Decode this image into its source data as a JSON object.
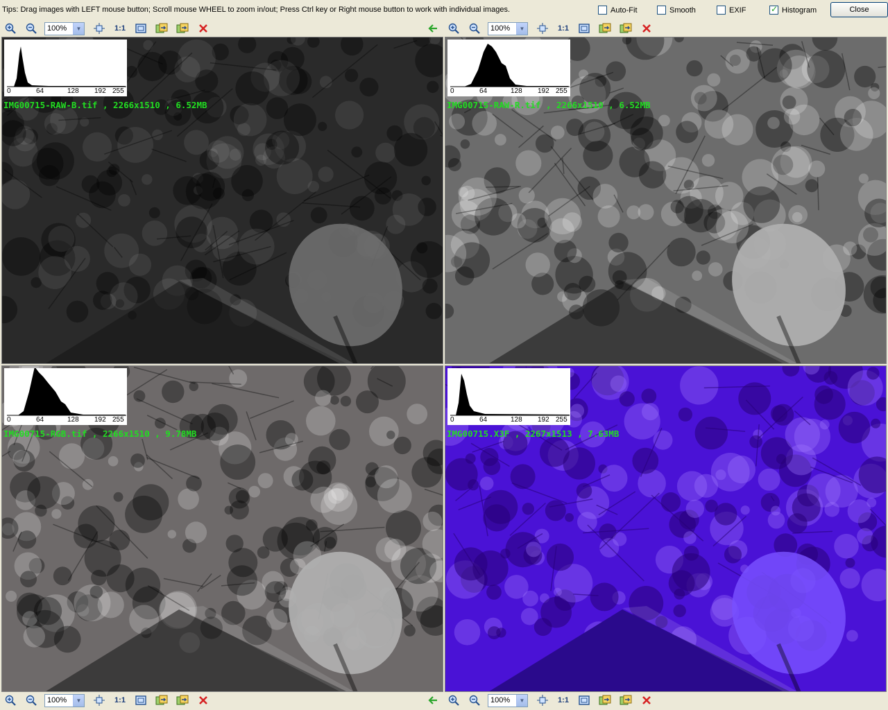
{
  "tips": "Tips: Drag images with LEFT mouse button; Scroll mouse WHEEL to zoom in/out; Press Ctrl key or Right mouse button to work with individual images.",
  "options": [
    {
      "label": "Auto-Fit",
      "checked": false
    },
    {
      "label": "Smooth",
      "checked": false
    },
    {
      "label": "EXIF",
      "checked": false
    },
    {
      "label": "Histogram",
      "checked": true
    }
  ],
  "close_label": "Close",
  "toolbar": {
    "zoom_value": "100%",
    "actual_size_label": "1:1",
    "icons": [
      "zoom-in-icon",
      "zoom-out-icon",
      "fit-icon",
      "actual-size-icon",
      "full-screen-icon",
      "rotate-left-icon",
      "rotate-right-icon",
      "close-image-icon"
    ]
  },
  "histogram_ticks": [
    "0",
    "64",
    "128",
    "192",
    "255"
  ],
  "panels": [
    {
      "caption": "IMG00715-RAW-B.tif , 2266x1510 , 6.52MB",
      "tint": "#2a2a2a"
    },
    {
      "caption": "IMG00715-RAW-R.tif , 2266x1510 , 6.52MB",
      "tint": "#6c6c6c"
    },
    {
      "caption": "IMG00715-RGB.tif , 2266x1510 , 9.78MB",
      "tint": "#6e6a6a"
    },
    {
      "caption": "IMG00715.X3F , 2267x1513 , 7.63MB",
      "tint": "#4a12d6"
    }
  ],
  "colors": {
    "caption": "#22dd22",
    "delete": "#d62222",
    "back_arrow": "#2aa52a"
  }
}
